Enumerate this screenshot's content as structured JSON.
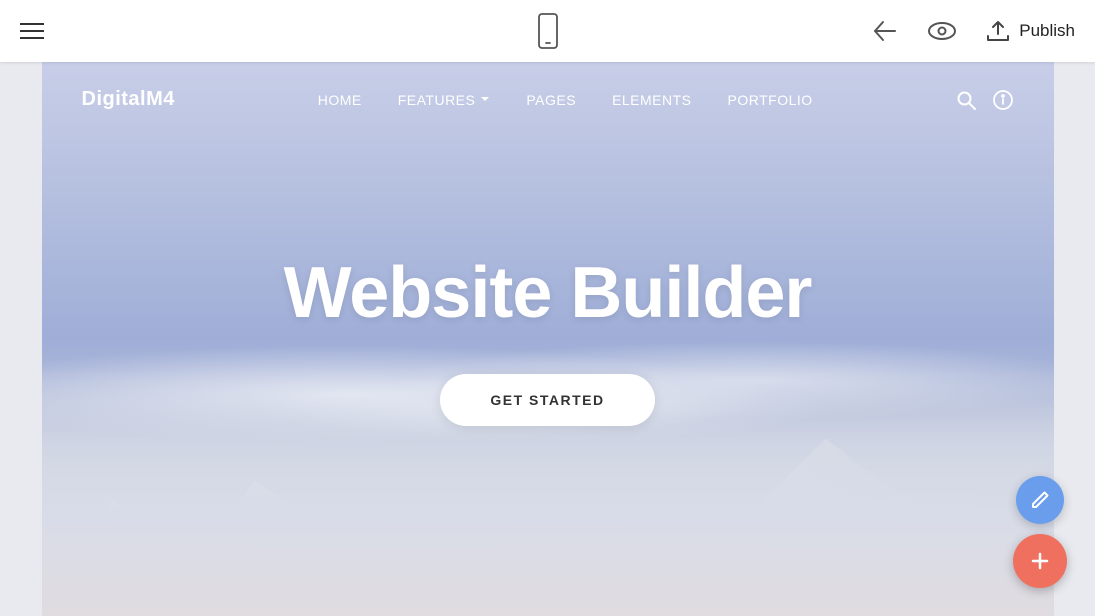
{
  "toolbar": {
    "hamburger_label": "menu",
    "back_label": "back",
    "preview_label": "preview",
    "publish_label": "Publish",
    "phone_icon": "phone",
    "back_icon": "arrow-left",
    "eye_icon": "eye",
    "upload_icon": "cloud-upload"
  },
  "site": {
    "logo": "DigitalM4",
    "nav": {
      "items": [
        {
          "label": "HOME",
          "has_dropdown": false
        },
        {
          "label": "FEATURES",
          "has_dropdown": true
        },
        {
          "label": "PAGES",
          "has_dropdown": false
        },
        {
          "label": "ELEMENTS",
          "has_dropdown": false
        },
        {
          "label": "PORTFOLIO",
          "has_dropdown": false
        }
      ]
    },
    "hero": {
      "title": "Website Builder",
      "cta_label": "GET STARTED"
    }
  },
  "fabs": {
    "edit_icon": "pencil",
    "add_icon": "plus"
  },
  "colors": {
    "accent_blue": "#6b9ded",
    "accent_red": "#f07060",
    "toolbar_bg": "#ffffff",
    "hero_gradient_top": "#c8cee8",
    "hero_gradient_bottom": "#d8dce8"
  }
}
